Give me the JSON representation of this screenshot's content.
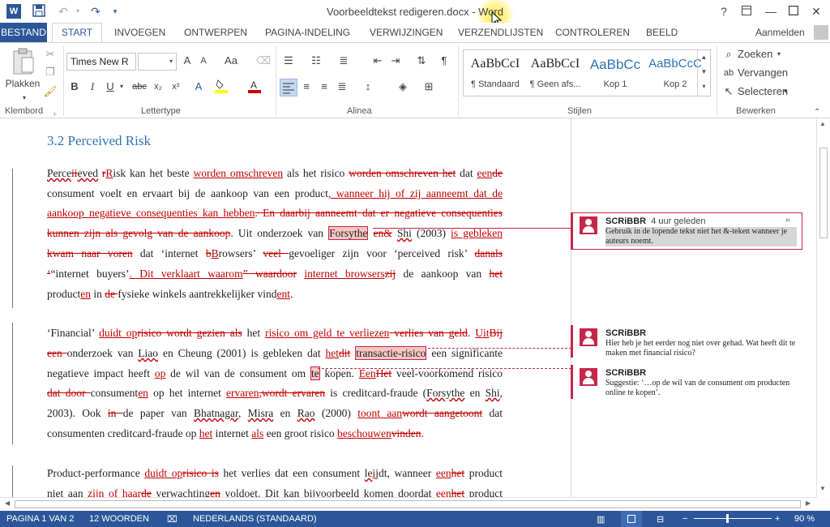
{
  "title_bar": {
    "document_title": "Voorbeeldtekst redigeren.docx - Word",
    "word_icon": "word-app-icon",
    "qat": [
      "save-icon",
      "undo-icon",
      "redo-icon",
      "customize-qat-icon"
    ],
    "window": {
      "help": "?",
      "ribbon_display": "ribbon-display-icon",
      "minimize": "minimize-icon",
      "maximize": "maximize-icon",
      "close": "close-icon"
    }
  },
  "tabs": {
    "file": "BESTAND",
    "items": [
      "START",
      "INVOEGEN",
      "ONTWERPEN",
      "PAGINA-INDELING",
      "VERWIJZINGEN",
      "VERZENDLIJSTEN",
      "CONTROLEREN",
      "BEELD"
    ],
    "active": "START",
    "sign_in": "Aanmelden"
  },
  "ribbon": {
    "clipboard": {
      "label": "Klembord",
      "paste": "Plakken"
    },
    "font": {
      "label": "Lettertype",
      "font_name": "Times New R",
      "font_size": "",
      "bold": "B",
      "italic": "I",
      "underline": "U",
      "strike": "abc",
      "subscript": "x₂",
      "superscript": "x²",
      "grow": "A",
      "shrink": "A",
      "case": "Aa"
    },
    "paragraph": {
      "label": "Alinea"
    },
    "styles": {
      "label": "Stijlen",
      "items": [
        {
          "sample": "AaBbCcI",
          "name": "¶ Standaard"
        },
        {
          "sample": "AaBbCcI",
          "name": "¶ Geen afs..."
        },
        {
          "sample": "AaBbCc",
          "name": "Kop 1"
        },
        {
          "sample": "AaBbCcC",
          "name": "Kop 2"
        }
      ]
    },
    "editing": {
      "label": "Bewerken",
      "find": "Zoeken",
      "replace": "Vervangen",
      "select": "Selecteren"
    }
  },
  "document": {
    "heading": "3.2 Perceived Risk"
  },
  "comments": [
    {
      "author": "SCRiBBR",
      "time": "4 uur geleden",
      "text": "Gebruik in de lopende tekst niet het &-teken wanneer je auteurs noemt."
    },
    {
      "author": "SCRiBBR",
      "time": "",
      "text": "Hier heb je het eerder nog niet over gehad. Wat heeft dit te maken met financial risico?"
    },
    {
      "author": "SCRiBBR",
      "time": "",
      "text": "Suggestie: ‘…op de wil van de consument om producten online te kopen’."
    }
  ],
  "status_bar": {
    "page": "PAGINA 1 VAN 2",
    "words": "12 WOORDEN",
    "language": "NEDERLANDS (STANDAARD)",
    "zoom": "90 %"
  },
  "colors": {
    "accent": "#2b579a",
    "revision": "#c00000",
    "comment": "#c6264a",
    "heading": "#2e74b5"
  }
}
